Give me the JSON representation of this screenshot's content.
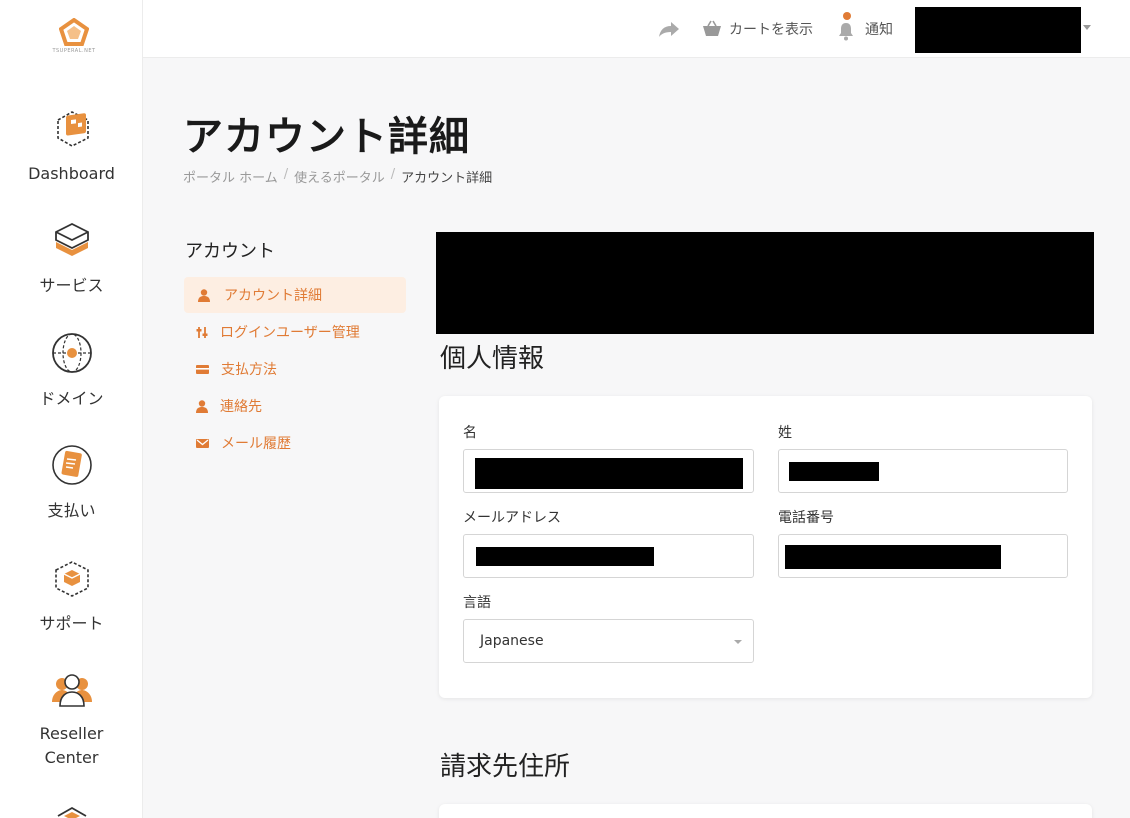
{
  "brand": {
    "logo_text": "TSUPERAL.NET",
    "accent": "#e07b35"
  },
  "sidebar": {
    "items": [
      {
        "label": "Dashboard",
        "icon": "dashboard-icon"
      },
      {
        "label": "サービス",
        "icon": "service-box-icon"
      },
      {
        "label": "ドメイン",
        "icon": "globe-icon"
      },
      {
        "label": "支払い",
        "icon": "billing-document-icon"
      },
      {
        "label": "サポート",
        "icon": "support-box-icon"
      },
      {
        "label": "Reseller Center",
        "icon": "reseller-people-icon"
      }
    ]
  },
  "header": {
    "share_icon": "share-arrow-icon",
    "cart_label": "カートを表示",
    "notify_label": "通知"
  },
  "page": {
    "title": "アカウント詳細",
    "breadcrumb": [
      "ポータル ホーム",
      "使えるポータル",
      "アカウント詳細"
    ]
  },
  "account_nav": {
    "title": "アカウント",
    "items": [
      {
        "label": "アカウント詳細",
        "icon": "user-icon",
        "active": true
      },
      {
        "label": "ログインユーザー管理",
        "icon": "sliders-icon",
        "active": false
      },
      {
        "label": "支払方法",
        "icon": "credit-card-icon",
        "active": false
      },
      {
        "label": "連絡先",
        "icon": "user-icon",
        "active": false
      },
      {
        "label": "メール履歴",
        "icon": "envelope-icon",
        "active": false
      }
    ]
  },
  "personal": {
    "section_title": "個人情報",
    "first_name_label": "名",
    "last_name_label": "姓",
    "email_label": "メールアドレス",
    "phone_label": "電話番号",
    "language_label": "言語",
    "language_value": "Japanese"
  },
  "billing": {
    "section_title": "請求先住所"
  }
}
